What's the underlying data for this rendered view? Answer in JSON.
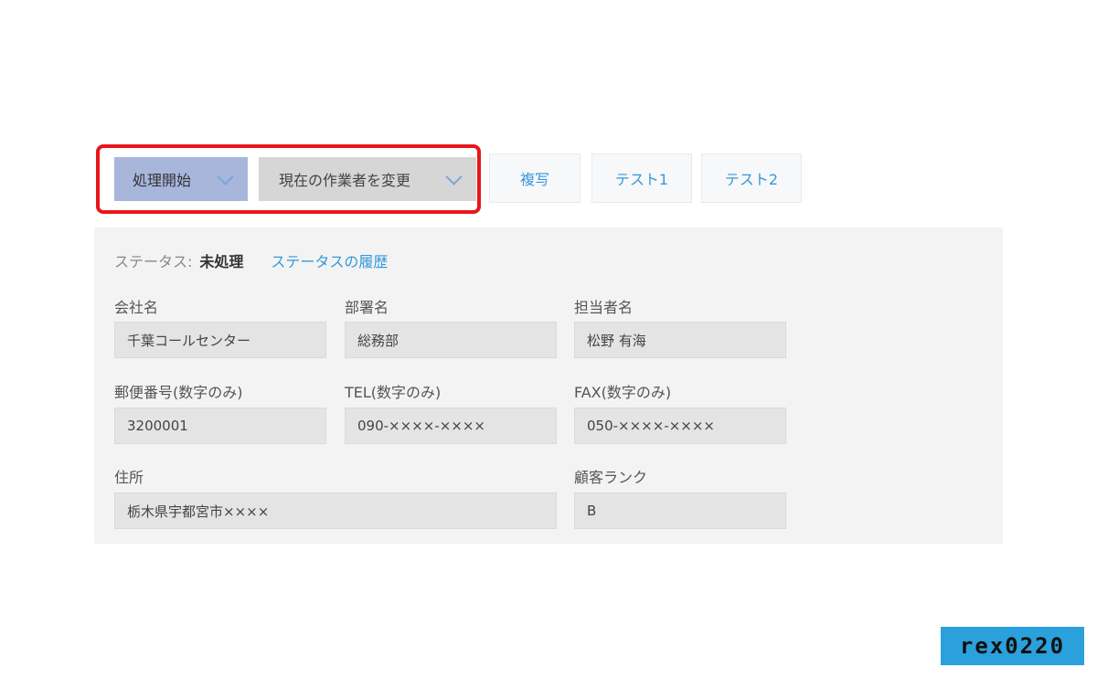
{
  "toolbar": {
    "start_label": "処理開始",
    "change_assignee_label": "現在の作業者を変更",
    "copy_label": "複写",
    "test1_label": "テスト1",
    "test2_label": "テスト2",
    "highlight_color": "#e8161b"
  },
  "status": {
    "label": "ステータス:",
    "value": "未処理",
    "history_link": "ステータスの履歴"
  },
  "fields": {
    "company": {
      "label": "会社名",
      "value": "千葉コールセンター"
    },
    "department": {
      "label": "部署名",
      "value": "総務部"
    },
    "contact": {
      "label": "担当者名",
      "value": "松野 有海"
    },
    "postal": {
      "label": "郵便番号(数字のみ)",
      "value": "3200001"
    },
    "tel": {
      "label": "TEL(数字のみ)",
      "value": "090-××××-××××"
    },
    "fax": {
      "label": "FAX(数字のみ)",
      "value": "050-××××-××××"
    },
    "address": {
      "label": "住所",
      "value": "栃木県宇都宮市××××"
    },
    "rank": {
      "label": "顧客ランク",
      "value": "B"
    }
  },
  "watermark": {
    "text": "rex0220",
    "color": "#2aa0dc"
  }
}
